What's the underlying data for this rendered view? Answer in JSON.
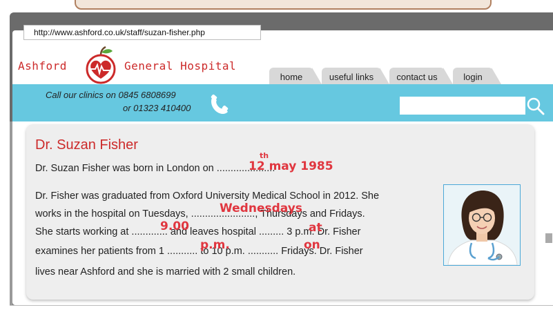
{
  "browser": {
    "url": "http://www.ashford.co.uk/staff/suzan-fisher.php"
  },
  "brand": {
    "name_left": "Ashford",
    "name_right": "General Hospital",
    "accent_red": "#cc2a2a",
    "band_blue": "#66c8e0"
  },
  "nav": {
    "items": [
      {
        "label": "home"
      },
      {
        "label": "useful links"
      },
      {
        "label": "contact us"
      },
      {
        "label": "login"
      }
    ]
  },
  "contact": {
    "line1": "Call our clinics on 0845 6808699",
    "line2": "or 01323 410400",
    "icon": "phone-icon"
  },
  "search": {
    "placeholder": "",
    "icon": "search-icon"
  },
  "profile": {
    "title": "Dr. Suzan Fisher",
    "p1": "Dr. Suzan Fisher was born in London on .....................",
    "l1": "Dr. Fisher was graduated from Oxford University Medical School in 2012. She",
    "l2": "works in the hospital on Tuesdays, ......................., Thursdays and Fridays.",
    "l3": "She starts working at ............. and leaves hospital ......... 3 p.m. Dr. Fisher",
    "l4": "examines her patients from 1 ........... to 10 p.m. ........... Fridays. Dr. Fisher",
    "l5": "lives near Ashford and she is married with 2 small children.",
    "answers": {
      "date_sup": "th",
      "date": "12 may 1985",
      "day": "Wednesdays",
      "time": "9.00",
      "prep1": "at",
      "meridiem": "p.m.",
      "prep2": "on"
    },
    "handwriting_color": "#e0363f"
  }
}
